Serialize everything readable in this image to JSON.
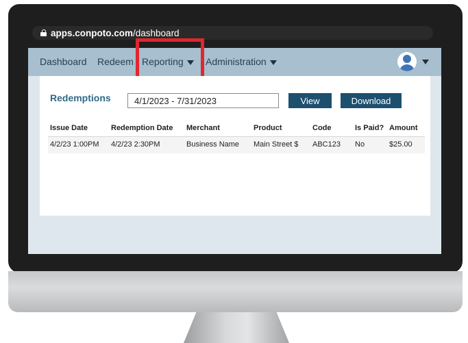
{
  "browser": {
    "url_domain": "apps.conpoto.com",
    "url_path": "/dashboard"
  },
  "nav": {
    "items": [
      {
        "label": "Dashboard",
        "has_dropdown": false
      },
      {
        "label": "Redeem",
        "has_dropdown": false
      },
      {
        "label": "Reporting",
        "has_dropdown": true,
        "highlighted": true
      },
      {
        "label": "Administration",
        "has_dropdown": true
      }
    ],
    "user_menu_icon": "user-avatar-icon"
  },
  "redemptions": {
    "title": "Redemptions",
    "date_range": "4/1/2023 - 7/31/2023",
    "view_label": "View",
    "download_label": "Download",
    "columns": [
      "Issue Date",
      "Redemption Date",
      "Merchant",
      "Product",
      "Code",
      "Is Paid?",
      "Amount"
    ],
    "rows": [
      [
        "4/2/23 1:00PM",
        "4/2/23 2:30PM",
        "Business Name",
        "Main Street $",
        "ABC123",
        "No",
        "$25.00"
      ]
    ]
  },
  "colors": {
    "nav_background": "#a7bfcf",
    "accent_button": "#1d4f6f",
    "title_text": "#2e6a86",
    "highlight_box": "#e0262e"
  }
}
